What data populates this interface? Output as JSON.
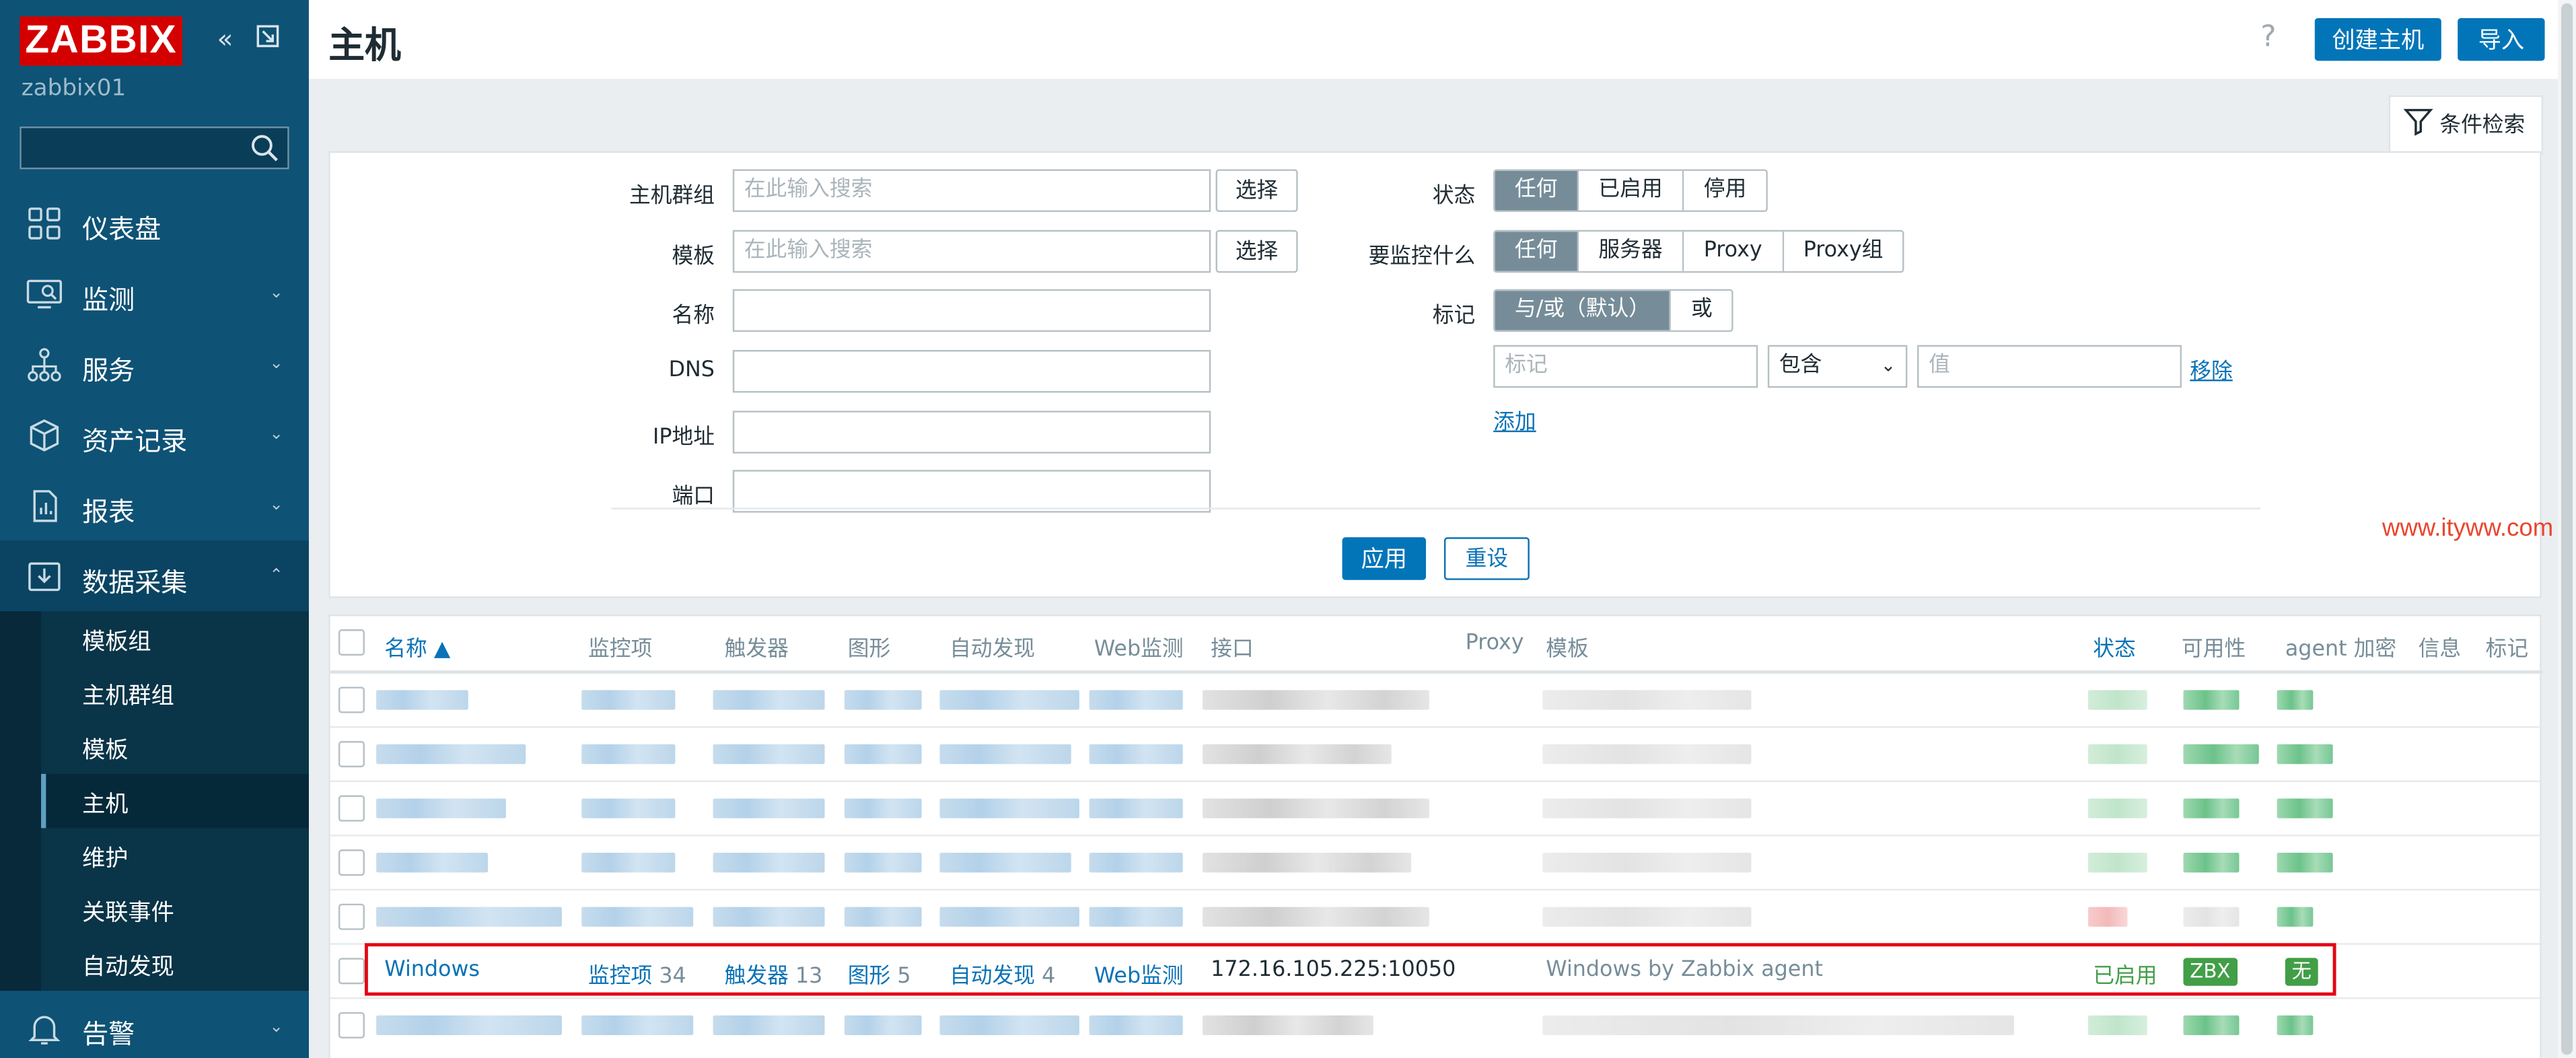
{
  "sidebar": {
    "logo": "ZABBIX",
    "server_name": "zabbix01",
    "search_placeholder": "",
    "items": [
      {
        "label": "仪表盘",
        "icon": "dashboard-icon"
      },
      {
        "label": "监测",
        "icon": "monitoring-icon"
      },
      {
        "label": "服务",
        "icon": "services-icon"
      },
      {
        "label": "资产记录",
        "icon": "inventory-icon"
      },
      {
        "label": "报表",
        "icon": "reports-icon"
      },
      {
        "label": "数据采集",
        "icon": "data-collection-icon"
      }
    ],
    "submenu": [
      "模板组",
      "主机群组",
      "模板",
      "主机",
      "维护",
      "关联事件",
      "自动发现"
    ],
    "bottom_item": {
      "label": "告警",
      "icon": "bell-icon"
    }
  },
  "header": {
    "title": "主机",
    "help": "?",
    "create_host": "创建主机",
    "import": "导入"
  },
  "filter": {
    "tab_label": "条件检索",
    "host_groups_label": "主机群组",
    "host_groups_placeholder": "在此输入搜索",
    "templates_label": "模板",
    "templates_placeholder": "在此输入搜索",
    "select_label": "选择",
    "name_label": "名称",
    "dns_label": "DNS",
    "ip_label": "IP地址",
    "port_label": "端口",
    "status_label": "状态",
    "status_options": [
      "任何",
      "已启用",
      "停用"
    ],
    "monitored_by_label": "要监控什么",
    "monitored_by_options": [
      "任何",
      "服务器",
      "Proxy",
      "Proxy组"
    ],
    "tags_label": "标记",
    "tags_options": [
      "与/或（默认）",
      "或"
    ],
    "tag_placeholder": "标记",
    "tag_operator": "包含",
    "value_placeholder": "值",
    "remove": "移除",
    "add": "添加",
    "apply": "应用",
    "reset": "重设"
  },
  "table": {
    "headers": [
      "名称 ▲",
      "监控项",
      "触发器",
      "图形",
      "自动发现",
      "Web监测",
      "接口",
      "Proxy",
      "模板",
      "状态",
      "可用性",
      "agent 加密",
      "信息",
      "标记"
    ],
    "highlighted_row": {
      "name": "Windows",
      "items_label": "监控项",
      "items_count": "34",
      "triggers_label": "触发器",
      "triggers_count": "13",
      "graphs_label": "图形",
      "graphs_count": "5",
      "discovery_label": "自动发现",
      "discovery_count": "4",
      "web_label": "Web监测",
      "interface": "172.16.105.225:10050",
      "template": "Windows by Zabbix agent",
      "status": "已启用",
      "availability": "ZBX",
      "encryption": "无"
    }
  },
  "watermark": "www.ityww.com",
  "colors": {
    "sidebar_bg": "#0e5275",
    "logo_red": "#d40000",
    "primary_blue": "#0275b8",
    "link_blue": "#0a72b6",
    "status_green": "#429e47",
    "highlight_red": "#e30613"
  }
}
